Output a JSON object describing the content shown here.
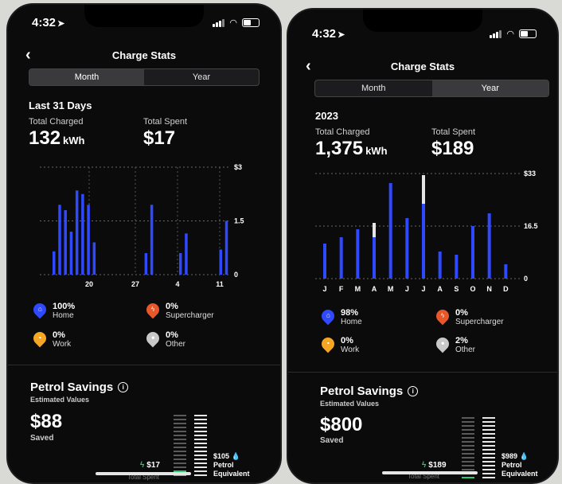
{
  "screens": [
    {
      "status": {
        "time": "4:32"
      },
      "nav": {
        "title": "Charge Stats"
      },
      "tabs": {
        "month": "Month",
        "year": "Year",
        "selected": "Month"
      },
      "period": "Last 31 Days",
      "total_charged": {
        "label": "Total Charged",
        "value": "132",
        "unit": "kWh"
      },
      "total_spent": {
        "label": "Total Spent",
        "value": "$17"
      },
      "legend": [
        {
          "pct": "100%",
          "name": "Home",
          "icon": "home-icon",
          "color": "#2f49ff"
        },
        {
          "pct": "0%",
          "name": "Supercharger",
          "icon": "bolt-icon",
          "color": "#e8572a"
        },
        {
          "pct": "0%",
          "name": "Work",
          "icon": "briefcase-icon",
          "color": "#f5a623"
        },
        {
          "pct": "0%",
          "name": "Other",
          "icon": "pin-icon",
          "color": "#c8c8c8"
        }
      ],
      "savings": {
        "title": "Petrol Savings",
        "estimated": "Estimated Values",
        "value": "$88",
        "saved_label": "Saved",
        "spent_value": "$17",
        "petrol_value": "$105",
        "petrol_label_1": "Petrol",
        "petrol_label_2": "Equivalent",
        "spent_caption": "Total Spent"
      }
    },
    {
      "status": {
        "time": "4:32"
      },
      "nav": {
        "title": "Charge Stats"
      },
      "tabs": {
        "month": "Month",
        "year": "Year",
        "selected": "Year"
      },
      "period": "2023",
      "total_charged": {
        "label": "Total Charged",
        "value": "1,375",
        "unit": "kWh"
      },
      "total_spent": {
        "label": "Total Spent",
        "value": "$189"
      },
      "legend": [
        {
          "pct": "98%",
          "name": "Home",
          "icon": "home-icon",
          "color": "#2f49ff"
        },
        {
          "pct": "0%",
          "name": "Supercharger",
          "icon": "bolt-icon",
          "color": "#e8572a"
        },
        {
          "pct": "0%",
          "name": "Work",
          "icon": "briefcase-icon",
          "color": "#f5a623"
        },
        {
          "pct": "2%",
          "name": "Other",
          "icon": "pin-icon",
          "color": "#c8c8c8"
        }
      ],
      "savings": {
        "title": "Petrol Savings",
        "estimated": "Estimated Values",
        "value": "$800",
        "saved_label": "Saved",
        "spent_value": "$189",
        "petrol_value": "$989",
        "petrol_label_1": "Petrol",
        "petrol_label_2": "Equivalent",
        "spent_caption": "Total Spent"
      }
    }
  ],
  "chart_data": [
    {
      "type": "bar",
      "x_tick_labels": [
        "20",
        "27",
        "4",
        "11"
      ],
      "y_tick_labels": [
        "$3",
        "1.5",
        "0"
      ],
      "ylim": [
        0,
        3
      ],
      "grid": true,
      "series": [
        {
          "color": "#2f49ff",
          "values": [
            0.65,
            1.95,
            1.8,
            1.2,
            2.35,
            2.25,
            1.95,
            0.9,
            0,
            0,
            0,
            0,
            0,
            0,
            0,
            0,
            0.6,
            1.95,
            0,
            0,
            0,
            0,
            0.6,
            1.15,
            0,
            0,
            0,
            0,
            0,
            0.7,
            1.5
          ]
        }
      ]
    },
    {
      "type": "bar",
      "categories": [
        "J",
        "F",
        "M",
        "A",
        "M",
        "J",
        "J",
        "A",
        "S",
        "O",
        "N",
        "D"
      ],
      "y_tick_labels": [
        "$33",
        "16.5",
        "0"
      ],
      "ylim": [
        0,
        33
      ],
      "grid": true,
      "series": [
        {
          "color": "#2f49ff",
          "values": [
            11,
            13,
            15.5,
            13,
            30,
            19,
            23.5,
            8.5,
            7.5,
            16.5,
            20.5,
            4.5
          ]
        },
        {
          "color": "#e5e5e5",
          "values": [
            0,
            0,
            0,
            4.5,
            0,
            0,
            9,
            0,
            0,
            0,
            0,
            0
          ]
        }
      ]
    }
  ]
}
